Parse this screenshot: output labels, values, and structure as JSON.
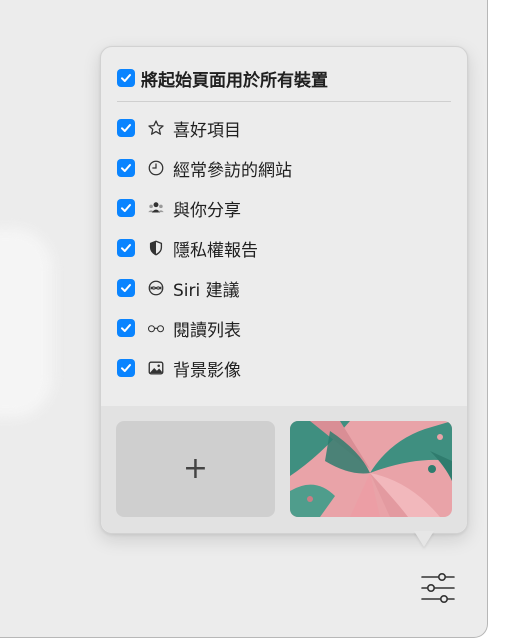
{
  "popover": {
    "main_toggle": {
      "label": "將起始頁面用於所有裝置",
      "checked": true
    },
    "items": [
      {
        "label": "喜好項目",
        "icon": "star-icon",
        "checked": true
      },
      {
        "label": "經常參訪的網站",
        "icon": "clock-icon",
        "checked": true
      },
      {
        "label": "與你分享",
        "icon": "people-icon",
        "checked": true
      },
      {
        "label": "隱私權報告",
        "icon": "shield-icon",
        "checked": true
      },
      {
        "label": "Siri 建議",
        "icon": "siri-icon",
        "checked": true
      },
      {
        "label": "閱讀列表",
        "icon": "glasses-icon",
        "checked": true
      },
      {
        "label": "背景影像",
        "icon": "photo-icon",
        "checked": true
      }
    ],
    "background": {
      "add_label": "+"
    }
  },
  "toolbar": {
    "settings_icon": "sliders-icon"
  },
  "colors": {
    "accent": "#0a84ff",
    "popover_bg": "#ececec",
    "thumb_pink": "#e9a3a8",
    "thumb_teal": "#3f8f80"
  }
}
